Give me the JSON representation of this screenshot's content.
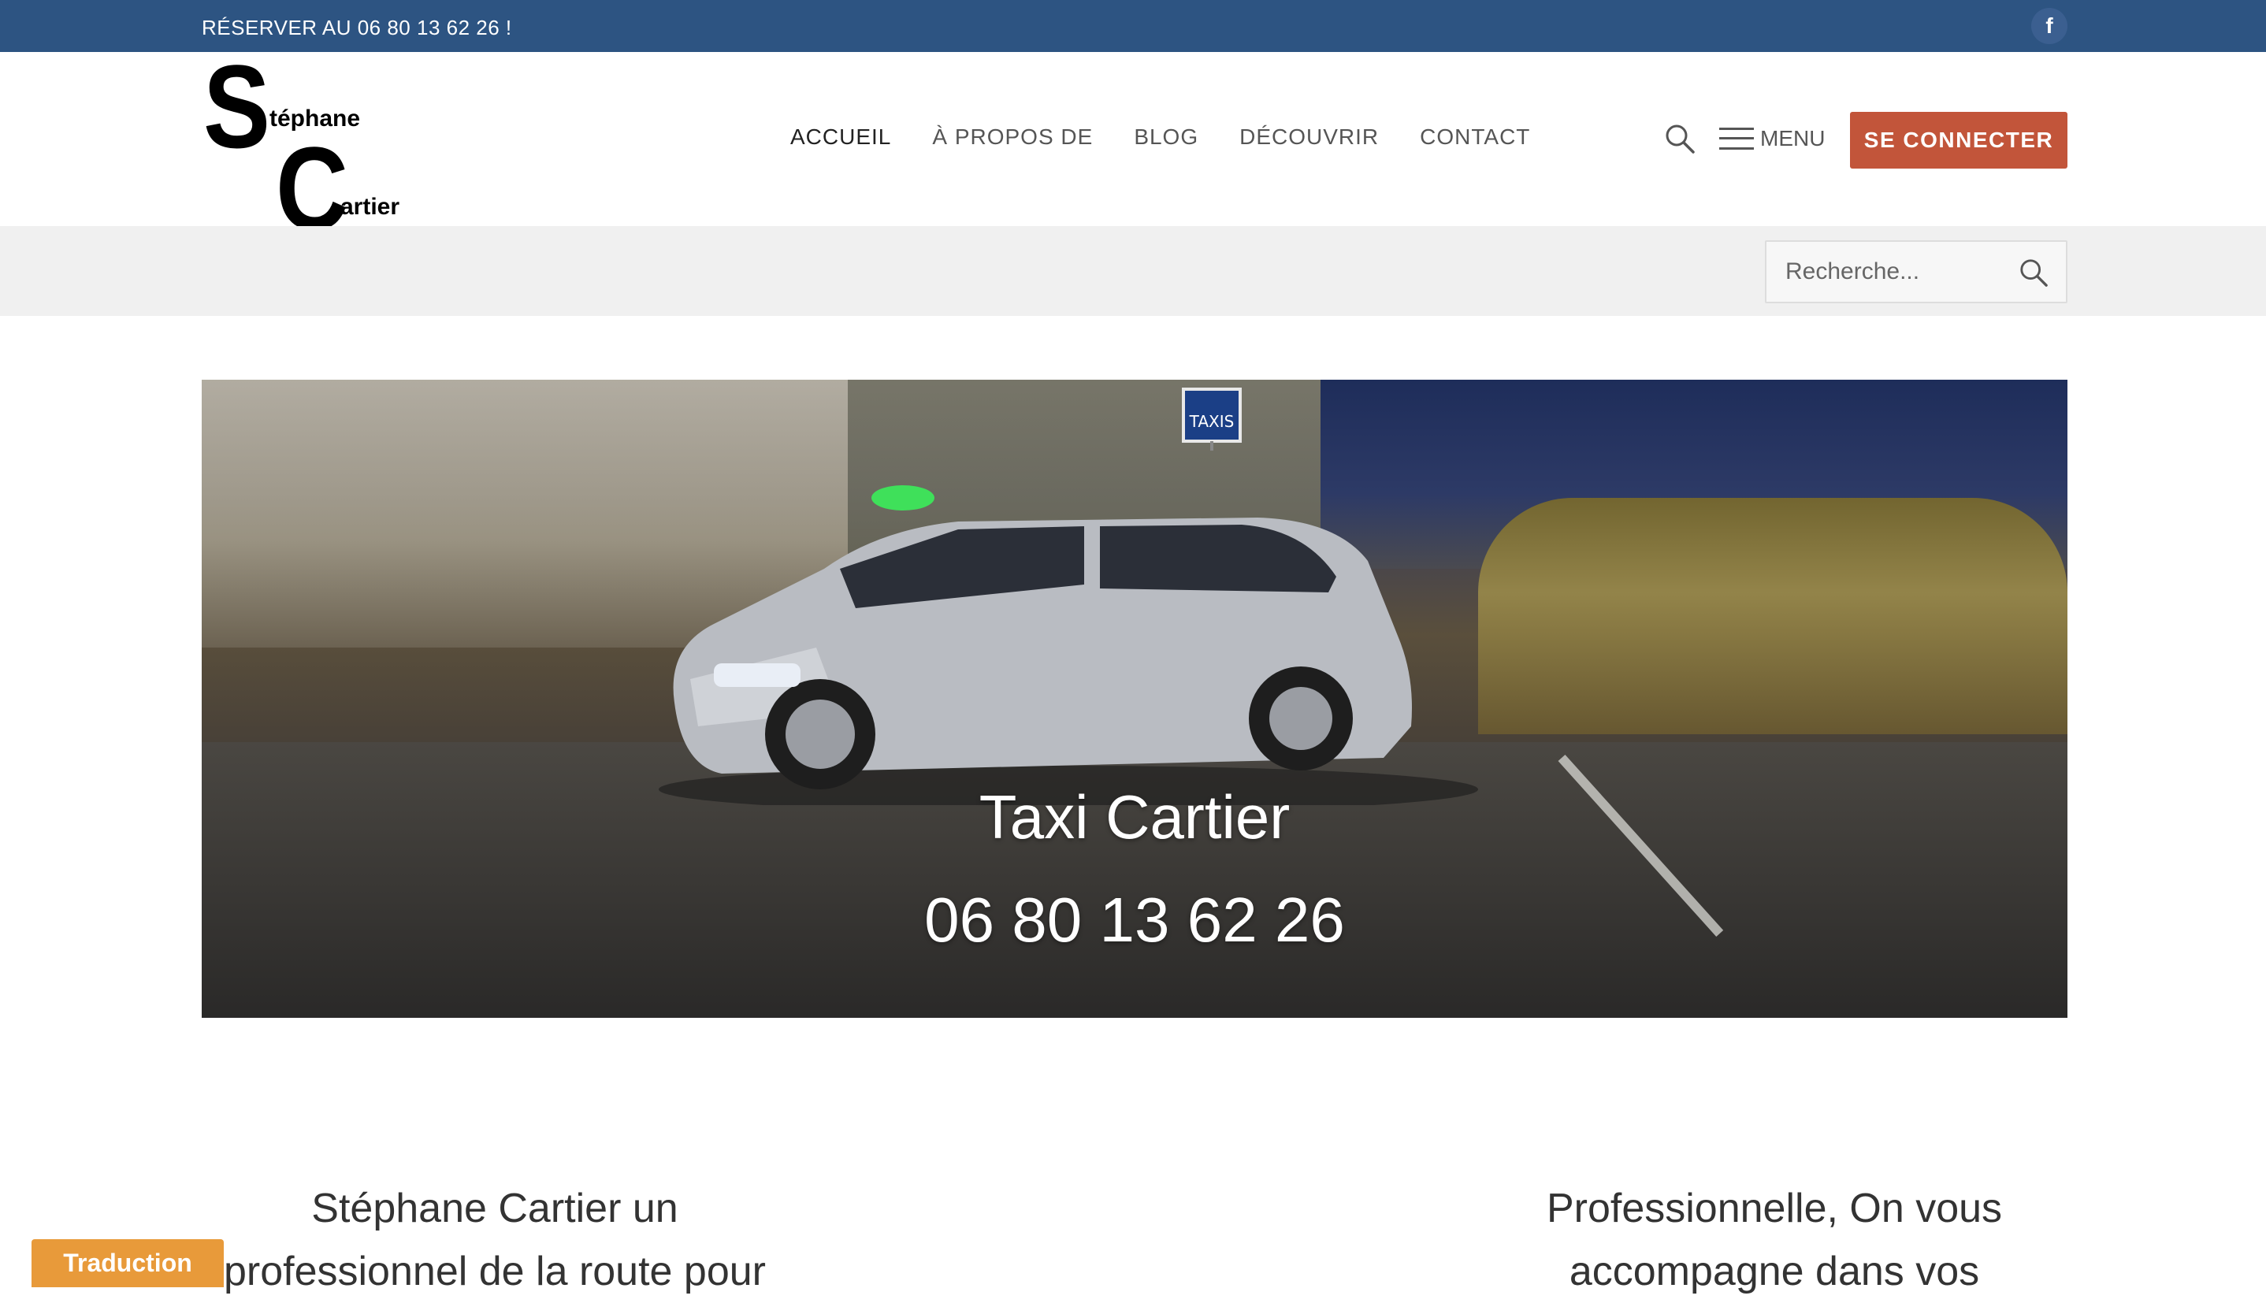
{
  "topbar": {
    "phone": "RÉSERVER AU 06 80 13 62 26 !",
    "facebook_glyph": "f"
  },
  "logo": {
    "letter_s": "S",
    "letter_c": "C",
    "first": "téphane",
    "last": "artier"
  },
  "nav": {
    "items": [
      "ACCUEIL",
      "À PROPOS DE",
      "BLOG",
      "DÉCOUVRIR",
      "CONTACT"
    ],
    "active": "ACCUEIL"
  },
  "header": {
    "menu_label": "MENU",
    "connect_label": "SE CONNECTER"
  },
  "search": {
    "placeholder": "Recherche..."
  },
  "hero": {
    "title": "Taxi Cartier",
    "phone": "06 80 13 62 26",
    "taxi_sign": "TAXIS"
  },
  "content": {
    "left_text": "Stéphane Cartier un professionnel de la route pour",
    "right_text": "Professionnelle, On vous accompagne dans vos"
  },
  "widget": {
    "translate_label": "Traduction"
  },
  "colors": {
    "topbar": "#2d5482",
    "connect_button": "#c2553a",
    "translate_button": "#e89a3a",
    "search_band": "#f0f0f0"
  }
}
